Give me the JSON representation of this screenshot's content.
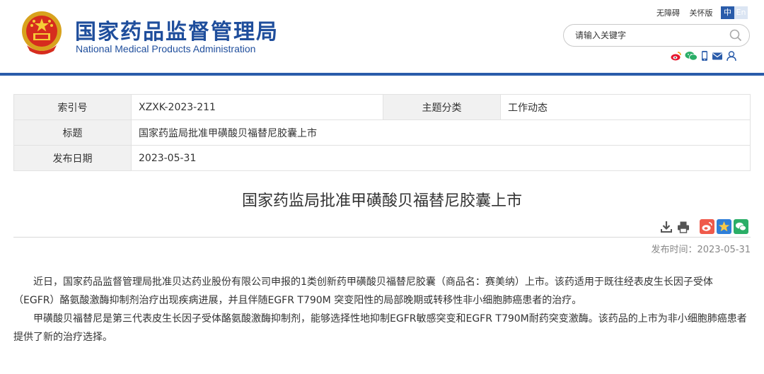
{
  "site": {
    "name_cn": "国家药品监督管理局",
    "name_en": "National Medical Products Administration"
  },
  "toplinks": {
    "accessibility": "无障碍",
    "care": "关怀版"
  },
  "lang": {
    "cn": "中",
    "en": "En"
  },
  "search": {
    "placeholder": "请输入关键字"
  },
  "social_icons": [
    "weibo-icon",
    "wechat-icon",
    "mobile-icon",
    "mail-icon",
    "user-icon"
  ],
  "meta": {
    "index_label": "索引号",
    "index_value": "XZXK-2023-211",
    "category_label": "主题分类",
    "category_value": "工作动态",
    "title_label": "标题",
    "title_value": "国家药监局批准甲磺酸贝福替尼胶囊上市",
    "date_label": "发布日期",
    "date_value": "2023-05-31"
  },
  "article": {
    "title": "国家药监局批准甲磺酸贝福替尼胶囊上市",
    "pubdate": "发布时间：2023-05-31",
    "paragraphs": [
      "近日，国家药品监督管理局批准贝达药业股份有限公司申报的1类创新药甲磺酸贝福替尼胶囊（商品名：赛美纳）上市。该药适用于既往经表皮生长因子受体（EGFR）酪氨酸激酶抑制剂治疗出现疾病进展，并且伴随EGFR T790M 突变阳性的局部晚期或转移性非小细胞肺癌患者的治疗。",
      "甲磺酸贝福替尼是第三代表皮生长因子受体酪氨酸激酶抑制剂，能够选择性地抑制EGFR敏感突变和EGFR T790M耐药突变激酶。该药品的上市为非小细胞肺癌患者提供了新的治疗选择。"
    ]
  },
  "colors": {
    "brand": "#1f4e9c",
    "bar": "#2a5caa",
    "weibo": "#e6162d",
    "star": "#2f7fd8",
    "wechat": "#2aae67"
  }
}
